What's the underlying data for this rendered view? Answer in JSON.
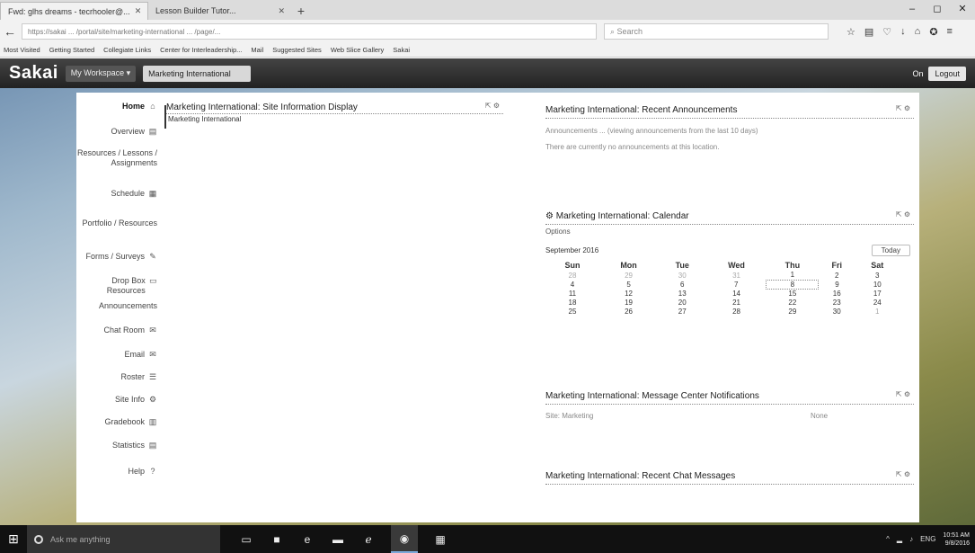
{
  "browser": {
    "tabs": [
      {
        "label": "Fwd: glhs dreams - tecrhooler@...",
        "active": true
      },
      {
        "label": "Lesson Builder Tutor...",
        "active": false
      }
    ],
    "new_tab": "+",
    "window_controls": {
      "minimize": "–",
      "maximize": "◻",
      "close": "✕"
    },
    "url": "https://sakai ... /portal/site/marketing-international ... /page/...",
    "search_placeholder": "Search",
    "bookmarks": [
      "Most Visited",
      "Getting Started",
      "Collegiate Links",
      "Center for Interleadership...",
      "Mail",
      "Suggested Sites",
      "Web Slice Gallery",
      "Sakai"
    ]
  },
  "sakai": {
    "logo": "Sakai",
    "workspace_tab": "My Workspace ▾",
    "current_site_tab": "Marketing International",
    "user": "On",
    "logout": "Logout"
  },
  "tools": [
    {
      "label": "Home",
      "icon": "⌂",
      "active": true
    },
    {
      "label": "Overview",
      "icon": "▤"
    },
    {
      "label": "Resources / Lessons / Assignments",
      "icon": ""
    },
    {
      "label": "Schedule",
      "icon": "▦"
    },
    {
      "label": "Portfolio / Resources",
      "icon": ""
    },
    {
      "label": "Forms / Surveys",
      "icon": "✎"
    },
    {
      "label": "Drop Box Resources",
      "icon": "▭"
    },
    {
      "label": "Announcements",
      "icon": ""
    },
    {
      "label": "Chat Room",
      "icon": "✉"
    },
    {
      "label": "Email",
      "icon": "✉"
    },
    {
      "label": "Roster",
      "icon": "☰"
    },
    {
      "label": "Site Info",
      "icon": "⚙"
    },
    {
      "label": "Gradebook",
      "icon": "▥"
    },
    {
      "label": "Statistics",
      "icon": "▤"
    },
    {
      "label": "Help",
      "icon": "?"
    }
  ],
  "site_info": {
    "title": "Marketing International: Site Information Display",
    "ctrls": "⇱ ⚙",
    "body": "Marketing International"
  },
  "announcements": {
    "title": "Marketing International: Recent Announcements",
    "ctrls": "⇱ ⚙",
    "lines": [
      "Announcements ... (viewing announcements from the last 10 days)",
      "There are currently no announcements at this location."
    ]
  },
  "calendar": {
    "title": "Marketing International: Calendar",
    "ctrls": "⇱ ⚙",
    "options": "Options",
    "month": "September 2016",
    "today_btn": "Today",
    "days": [
      "Sun",
      "Mon",
      "Tue",
      "Wed",
      "Thu",
      "Fri",
      "Sat"
    ],
    "weeks": [
      [
        "28",
        "29",
        "30",
        "31",
        "1",
        "2",
        "3"
      ],
      [
        "4",
        "5",
        "6",
        "7",
        "8",
        "9",
        "10"
      ],
      [
        "11",
        "12",
        "13",
        "14",
        "15",
        "16",
        "17"
      ],
      [
        "18",
        "19",
        "20",
        "21",
        "22",
        "23",
        "24"
      ],
      [
        "25",
        "26",
        "27",
        "28",
        "29",
        "30",
        "1"
      ]
    ]
  },
  "messages": {
    "title": "Marketing International: Message Center Notifications",
    "ctrls": "⇱ ⚙",
    "row_label": "Site: Marketing",
    "row_value": "None"
  },
  "chat": {
    "title": "Marketing International: Recent Chat Messages",
    "ctrls": "⇱ ⚙"
  },
  "taskbar": {
    "search_placeholder": "Ask me anything",
    "clock_time": "10:51 AM",
    "clock_date": "9/8/2016",
    "lang": "ENG"
  }
}
